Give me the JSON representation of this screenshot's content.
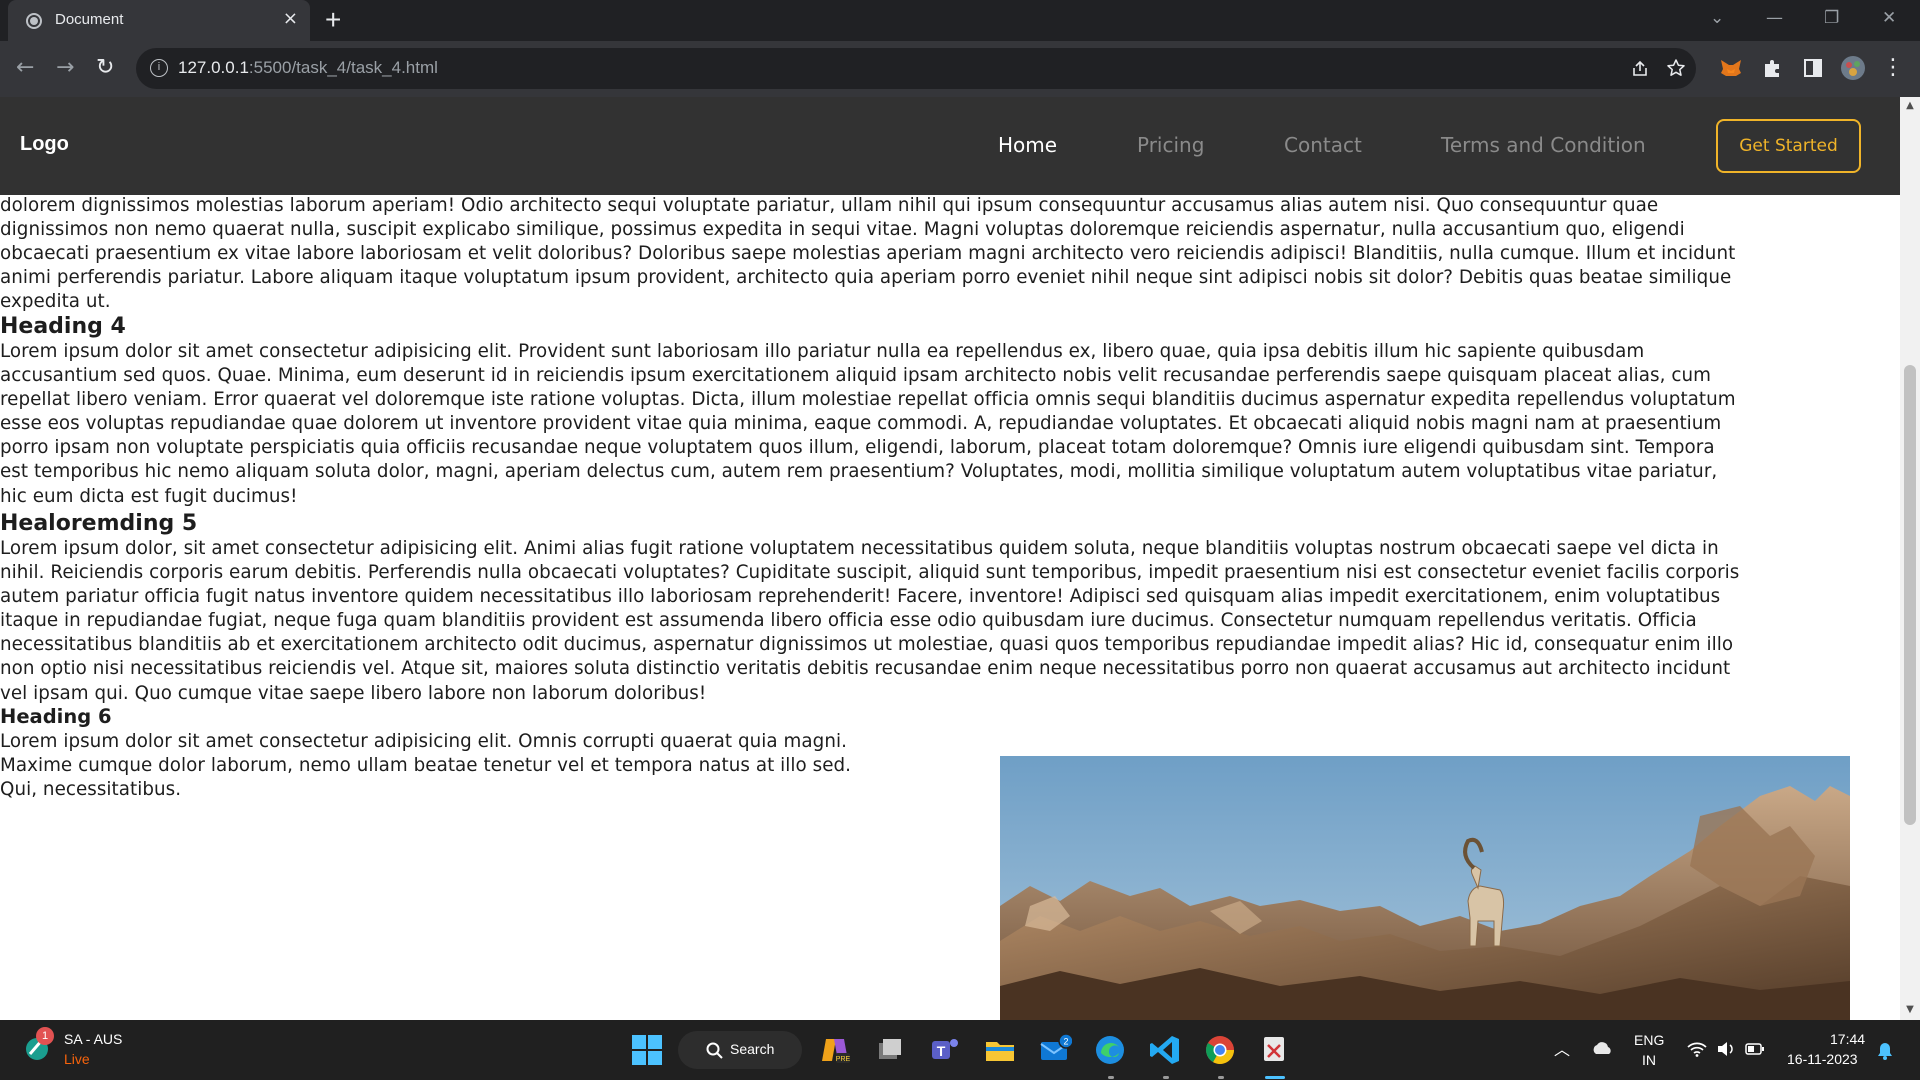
{
  "browser": {
    "tab_title": "Document",
    "tab_close": "×",
    "new_tab": "+",
    "url_host": "127.0.0.1",
    "url_path": ":5500/task_4/task_4.html",
    "window_controls": {
      "dropdown": "⌄",
      "minimize": "—",
      "restore": "❐",
      "close": "✕"
    },
    "nav": {
      "back": "←",
      "forward": "→",
      "reload": "↻"
    }
  },
  "navbar": {
    "logo": "Logo",
    "links": [
      "Home",
      "Pricing",
      "Contact",
      "Terms and Condition"
    ],
    "active_link": "Home",
    "cta": "Get Started",
    "accent_color": "#f0b429"
  },
  "content": {
    "top_paragraph": [
      "dolorem dignissimos molestias laborum aperiam! Odio architecto sequi voluptate pariatur, ullam nihil qui ipsum consequuntur accusamus alias autem nisi. Quo consequuntur quae",
      "dignissimos non nemo quaerat nulla, suscipit explicabo similique, possimus expedita in sequi vitae. Magni voluptas doloremque reiciendis aspernatur, nulla accusantium quo, eligendi",
      "obcaecati praesentium ex vitae labore laboriosam et velit doloribus? Doloribus saepe molestias aperiam magni architecto vero reiciendis adipisci! Blanditiis, nulla cumque. Illum et incidunt",
      "animi perferendis pariatur. Labore aliquam itaque voluptatum ipsum provident, architecto quia aperiam porro eveniet nihil neque sint adipisci nobis sit dolor? Debitis quas beatae similique",
      "expedita ut."
    ],
    "heading4": "Heading 4",
    "paragraph4": [
      "Lorem ipsum dolor sit amet consectetur adipisicing elit. Provident sunt laboriosam illo pariatur nulla ea repellendus ex, libero quae, quia ipsa debitis illum hic sapiente quibusdam",
      "accusantium sed quos. Quae. Minima, eum deserunt id in reiciendis ipsum exercitationem aliquid ipsam architecto nobis velit recusandae perferendis saepe quisquam placeat alias, cum",
      "repellat libero veniam. Error quaerat vel doloremque iste ratione voluptas. Dicta, illum molestiae repellat officia omnis sequi blanditiis ducimus aspernatur expedita repellendus voluptatum",
      "esse eos voluptas repudiandae quae dolorem ut inventore provident vitae quia minima, eaque commodi. A, repudiandae voluptates. Et obcaecati aliquid nobis magni nam at praesentium",
      "porro ipsam non voluptate perspiciatis quia officiis recusandae neque voluptatem quos illum, eligendi, laborum, placeat totam doloremque? Omnis iure eligendi quibusdam sint. Tempora",
      "est temporibus hic nemo aliquam soluta dolor, magni, aperiam delectus cum, autem rem praesentium? Voluptates, modi, mollitia similique voluptatum autem voluptatibus vitae pariatur,",
      "hic eum dicta est fugit ducimus!"
    ],
    "heading5": "Healoremding 5",
    "paragraph5": [
      "Lorem ipsum dolor, sit amet consectetur adipisicing elit. Animi alias fugit ratione voluptatem necessitatibus quidem soluta, neque blanditiis voluptas nostrum obcaecati saepe vel dicta in",
      "nihil. Reiciendis corporis earum debitis. Perferendis nulla obcaecati voluptates? Cupiditate suscipit, aliquid sunt temporibus, impedit praesentium nisi est consectetur eveniet facilis corporis",
      "autem pariatur officia fugit natus inventore quidem necessitatibus illo laboriosam reprehenderit! Facere, inventore! Adipisci sed quisquam alias impedit exercitationem, enim voluptatibus",
      "itaque in repudiandae fugiat, neque fuga quam blanditiis provident est assumenda libero officia esse odio quibusdam iure ducimus. Consectetur numquam repellendus veritatis. Officia",
      "necessitatibus blanditiis ab et exercitationem architecto odit ducimus, aspernatur dignissimos ut molestiae, quasi quos temporibus repudiandae impedit alias? Hic id, consequatur enim illo",
      "non optio nisi necessitatibus reiciendis vel. Atque sit, maiores soluta distinctio veritatis debitis recusandae enim neque necessitatibus porro non quaerat accusamus aut architecto incidunt",
      "vel ipsam qui. Quo cumque vitae saepe libero labore non laborum doloribus!"
    ],
    "heading6": "Heading 6",
    "paragraph6": [
      "Lorem ipsum dolor sit amet consectetur adipisicing elit. Omnis corrupti quaerat quia magni.",
      "Maxime cumque dolor laborum, nemo ullam beatae tenetur vel et tempora natus at illo sed.",
      "Qui, necessitatibus."
    ],
    "image_subject": "ibex-on-rocks"
  },
  "taskbar": {
    "weather_badge": "1",
    "weather_title": "SA - AUS",
    "weather_status": "Live",
    "search_label": "Search",
    "mail_badge": "2",
    "lang_1": "ENG",
    "lang_2": "IN",
    "time": "17:44",
    "date": "16-11-2023",
    "icons": [
      "start-icon",
      "search-icon",
      "copilot-icon",
      "task-view-icon",
      "teams-icon",
      "file-explorer-icon",
      "mail-icon",
      "edge-icon",
      "vscode-icon",
      "chrome-icon",
      "snipping-tool-icon"
    ]
  }
}
